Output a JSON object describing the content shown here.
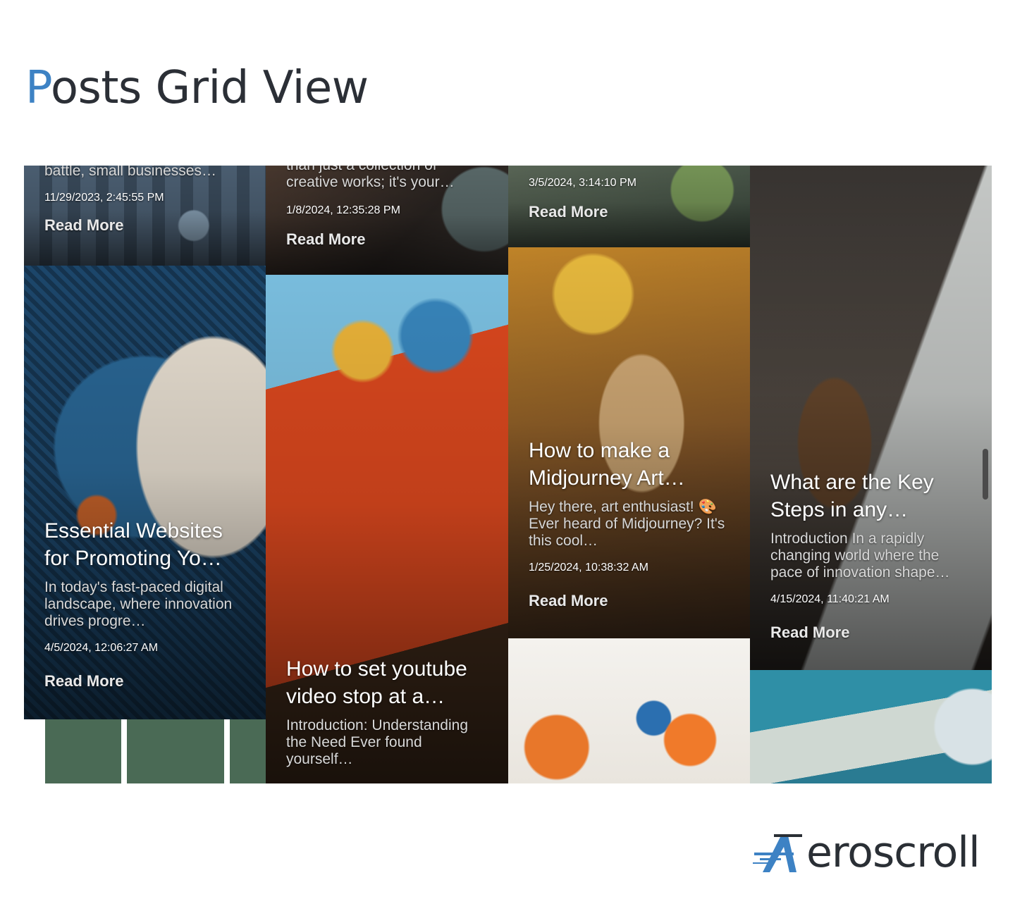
{
  "page": {
    "title_accent": "P",
    "title_rest": "osts Grid View"
  },
  "columns": [
    {
      "cards": [
        {
          "title": "",
          "excerpt": "battle, small businesses…",
          "date": "11/29/2023, 2:45:55 PM",
          "read_more": "Read More"
        },
        {
          "title": "Essential Websites for Promoting Yo…",
          "excerpt": "In today's fast-paced digital landscape, where innovation drives progre…",
          "date": "4/5/2024, 12:06:27 AM",
          "read_more": "Read More"
        }
      ]
    },
    {
      "cards": [
        {
          "title": "",
          "excerpt": "than just a collection of creative works; it's your…",
          "date": "1/8/2024, 12:35:28 PM",
          "read_more": "Read More"
        },
        {
          "title": "How to set youtube video stop at a…",
          "excerpt": "Introduction: Understanding the Need Ever found yourself…",
          "date": "",
          "read_more": ""
        }
      ]
    },
    {
      "cards": [
        {
          "title": "",
          "excerpt": "",
          "date": "3/5/2024, 3:14:10 PM",
          "read_more": "Read More"
        },
        {
          "title": "How to make a Midjourney Art…",
          "excerpt": "Hey there, art enthusiast! 🎨Ever heard of Midjourney? It's this cool…",
          "date": "1/25/2024, 10:38:32 AM",
          "read_more": "Read More"
        }
      ]
    },
    {
      "cards": [
        {
          "title": "What are the Key Steps in any…",
          "excerpt": "Introduction In a rapidly changing world where the pace of innovation shape…",
          "date": "4/15/2024, 11:40:21 AM",
          "read_more": "Read More"
        }
      ]
    }
  ],
  "brand": {
    "logo_icon": "aeroscroll-a-icon",
    "logo_text": "eroscroll",
    "accent_color": "#3d82c4",
    "dark_color": "#2a2f35"
  }
}
